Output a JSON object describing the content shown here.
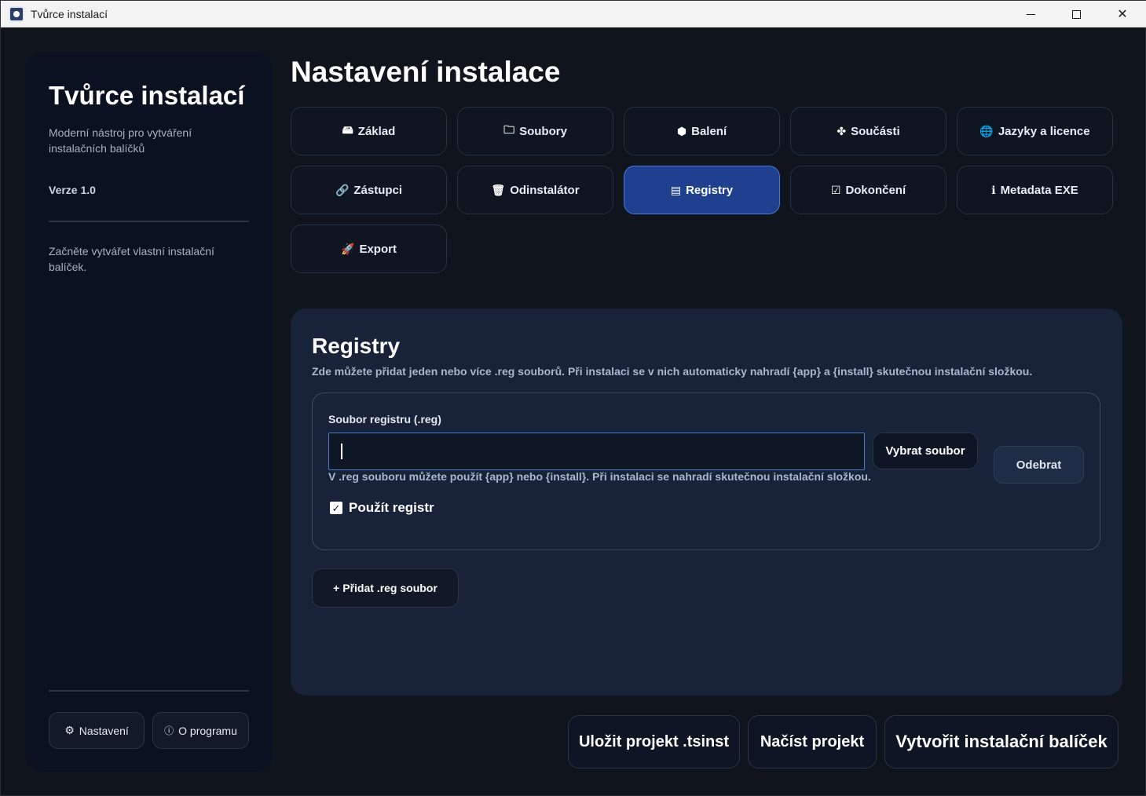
{
  "window": {
    "title": "Tvůrce instalací"
  },
  "sidebar": {
    "title": "Tvůrce instalací",
    "subtitle": "Moderní nástroj pro vytváření instalačních balíčků",
    "version": "Verze 1.0",
    "hint": "Začněte vytvářet vlastní instalační balíček.",
    "settings_label": "Nastavení",
    "about_label": "O programu"
  },
  "main": {
    "title": "Nastavení instalace",
    "tabs": [
      {
        "label": "Základ",
        "icon": "installer-icon",
        "glyph": "🖴"
      },
      {
        "label": "Soubory",
        "icon": "folder-icon",
        "glyph": "🗀"
      },
      {
        "label": "Balení",
        "icon": "package-icon",
        "glyph": "⬢"
      },
      {
        "label": "Součásti",
        "icon": "puzzle-icon",
        "glyph": "✤"
      },
      {
        "label": "Jazyky a licence",
        "icon": "globe-icon",
        "glyph": "🌐"
      },
      {
        "label": "Zástupci",
        "icon": "link-icon",
        "glyph": "🔗"
      },
      {
        "label": "Odinstalátor",
        "icon": "trash-icon",
        "glyph": "🗑"
      },
      {
        "label": "Registry",
        "icon": "registry-icon",
        "glyph": "▤",
        "active": true
      },
      {
        "label": "Dokončení",
        "icon": "checkbox-icon",
        "glyph": "☑"
      },
      {
        "label": "Metadata EXE",
        "icon": "info-icon",
        "glyph": "ℹ"
      },
      {
        "label": "Export",
        "icon": "rocket-icon",
        "glyph": "🚀"
      }
    ]
  },
  "panel": {
    "title": "Registry",
    "description": "Zde můžete přidat jeden nebo více .reg souborů. Při instalaci se v nich automaticky nahradí {app} a {install} skutečnou instalační složkou.",
    "entry": {
      "label": "Soubor registru (.reg)",
      "value": "",
      "browse_label": "Vybrat soubor",
      "remove_label": "Odebrat",
      "help": "V .reg souboru můžete použít {app} nebo {install}. Při instalaci se nahradí skutečnou instalační složkou.",
      "use_label": "Použít registr",
      "use_checked": true
    },
    "add_label": "+ Přidat .reg soubor"
  },
  "actions": {
    "save_label": "Uložit projekt .tsinst",
    "load_label": "Načíst projekt",
    "build_label": "Vytvořit instalační balíček"
  }
}
